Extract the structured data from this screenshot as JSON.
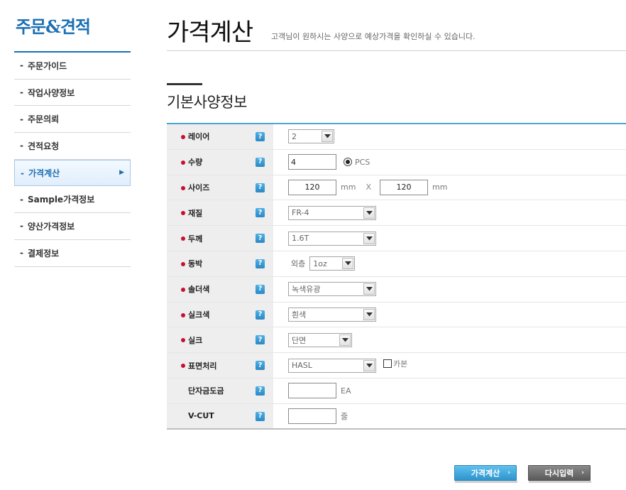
{
  "sidebar": {
    "title": "주문&견적",
    "items": [
      {
        "label": "주문가이드",
        "active": false
      },
      {
        "label": "작업사양정보",
        "active": false
      },
      {
        "label": "주문의뢰",
        "active": false
      },
      {
        "label": "견적요청",
        "active": false
      },
      {
        "label": "가격계산",
        "active": true
      },
      {
        "label": "Sample가격정보",
        "active": false
      },
      {
        "label": "양산가격정보",
        "active": false
      },
      {
        "label": "결제정보",
        "active": false
      }
    ],
    "dash": "-",
    "active_arrow": "▶"
  },
  "header": {
    "title": "가격계산",
    "subtitle": "고객님이 원하시는 사양으로 예상가격을 확인하실 수 있습니다."
  },
  "section": {
    "title": "기본사양정보"
  },
  "help_glyph": "?",
  "form": {
    "layer": {
      "label": "레이어",
      "value": "2"
    },
    "quantity": {
      "label": "수량",
      "value": "4",
      "unit": "PCS"
    },
    "size": {
      "label": "사이즈",
      "width": "120",
      "height": "120",
      "unit": "mm",
      "separator": "X"
    },
    "material": {
      "label": "재질",
      "value": "FR-4"
    },
    "thickness": {
      "label": "두께",
      "value": "1.6T"
    },
    "copper": {
      "label": "동박",
      "prefix": "외층",
      "value": "1oz"
    },
    "solder": {
      "label": "솔더색",
      "value": "녹색유광"
    },
    "silk_color": {
      "label": "실크색",
      "value": "흰색"
    },
    "silk": {
      "label": "실크",
      "value": "단면"
    },
    "surface": {
      "label": "표면처리",
      "value": "HASL",
      "checkbox_label": "카본"
    },
    "gold": {
      "label": "단자금도금",
      "value": "",
      "unit": "EA"
    },
    "vcut": {
      "label": "V-CUT",
      "value": "",
      "unit": "줄"
    }
  },
  "buttons": {
    "calc": "가격계산",
    "reset": "다시입력",
    "chevron": "›"
  },
  "colors": {
    "brand": "#1b6fb3",
    "accent": "#4aa6d6",
    "required_dot": "#c8102e"
  }
}
